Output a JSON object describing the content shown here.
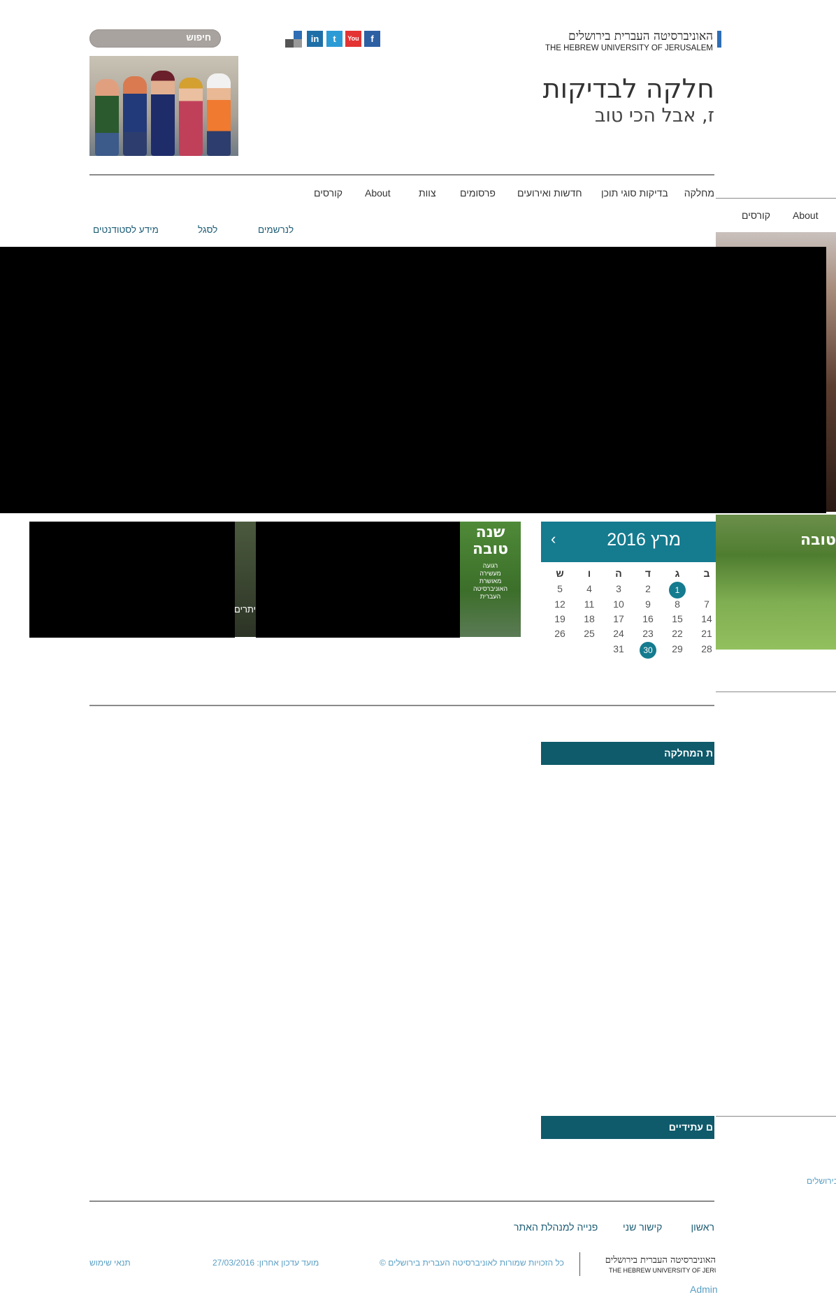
{
  "header": {
    "logo_he": "האוניברסיטה העברית בירושלים",
    "logo_en": "THE HEBREW UNIVERSITY OF JERUSALEM",
    "search_label": "חיפוש",
    "social": {
      "facebook": "f",
      "youtube": "You",
      "twitter": "t",
      "linkedin": "in"
    },
    "site_title": "חלקה לבדיקות",
    "site_subtitle": "ז, אבל הכי טוב"
  },
  "nav": {
    "items": [
      "מחלקה",
      "בדיקות סוגי תוכן",
      "חדשות ואירועים",
      "פרסומים",
      "צוות",
      "About",
      "קורסים"
    ]
  },
  "subnav": {
    "items": [
      "לנרשמים",
      "לסגל",
      "מידע לסטודנטים"
    ]
  },
  "overflow_nav": {
    "items": [
      "About",
      "קורסים"
    ]
  },
  "promo": {
    "card2_text": "יתרים",
    "card1_title": "שנה טובה",
    "card1_lines": [
      "רגועה",
      "מעשירה",
      "מאושרת",
      "האוניברסיטה",
      "העברית"
    ],
    "overflow_title_fragment": "טובה"
  },
  "calendar": {
    "title": "מרץ 2016",
    "prev_label": "‹",
    "weekday_headers": [
      "ש",
      "ו",
      "ה",
      "ד",
      "ג",
      "ב"
    ],
    "rows": [
      [
        "5",
        "4",
        "3",
        "2",
        "1",
        ""
      ],
      [
        "12",
        "11",
        "10",
        "9",
        "8",
        "7"
      ],
      [
        "19",
        "18",
        "17",
        "16",
        "15",
        "14"
      ],
      [
        "26",
        "25",
        "24",
        "23",
        "22",
        "21"
      ],
      [
        "",
        "",
        "31",
        "30",
        "29",
        "28"
      ]
    ],
    "highlighted": [
      "1",
      "30"
    ]
  },
  "sidebar": {
    "dept_heading": "ת המחלקה",
    "events_heading": "ם עתידיים",
    "overflow_link": "בירושלים"
  },
  "footer": {
    "links": [
      "ראשון",
      "קישור שני",
      "פנייה למנהלת האתר"
    ],
    "logo_he": "האוניברסיטה העברית בירושלים",
    "logo_en": "THE HEBREW UNIVERSITY OF JERUSALE",
    "copyright": "© כל הזכויות שמורות לאוניברסיטה העברית בירושלים",
    "last_update": "מועד עדכון אחרון: 27/03/2016",
    "terms": "תנאי שימוש",
    "admin": "Admin"
  },
  "colors": {
    "accent": "#157b8f",
    "dark_accent": "#0f5a6b",
    "link": "#1b5b74",
    "footer_small": "#5a9fc4"
  }
}
